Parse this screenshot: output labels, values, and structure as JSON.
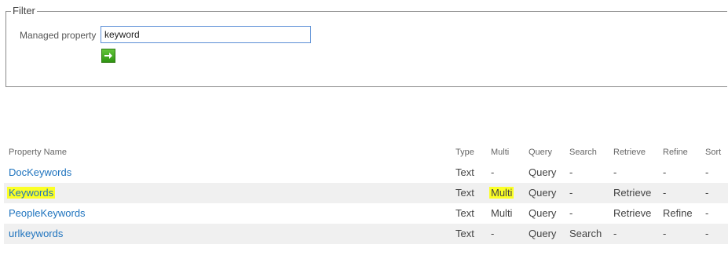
{
  "filter": {
    "legend": "Filter",
    "label": "Managed property",
    "value": "keyword",
    "go_icon": "arrow-right-icon",
    "go_color": "#3a9d1b"
  },
  "table": {
    "headers": [
      "Property Name",
      "Type",
      "Multi",
      "Query",
      "Search",
      "Retrieve",
      "Refine",
      "Sort"
    ],
    "rows": [
      {
        "name": "DocKeywords",
        "type": "Text",
        "multi": "-",
        "query": "Query",
        "search": "-",
        "retrieve": "-",
        "refine": "-",
        "sort": "-",
        "highlighted": false
      },
      {
        "name": "Keywords",
        "type": "Text",
        "multi": "Multi",
        "query": "Query",
        "search": "-",
        "retrieve": "Retrieve",
        "refine": "-",
        "sort": "-",
        "highlighted": true
      },
      {
        "name": "PeopleKeywords",
        "type": "Text",
        "multi": "Multi",
        "query": "Query",
        "search": "-",
        "retrieve": "Retrieve",
        "refine": "Refine",
        "sort": "-",
        "highlighted": false
      },
      {
        "name": "urlkeywords",
        "type": "Text",
        "multi": "-",
        "query": "Query",
        "search": "Search",
        "retrieve": "-",
        "refine": "-",
        "sort": "-",
        "highlighted": false
      }
    ],
    "link_color": "#1e73be",
    "highlight_color": "#fbff26"
  }
}
